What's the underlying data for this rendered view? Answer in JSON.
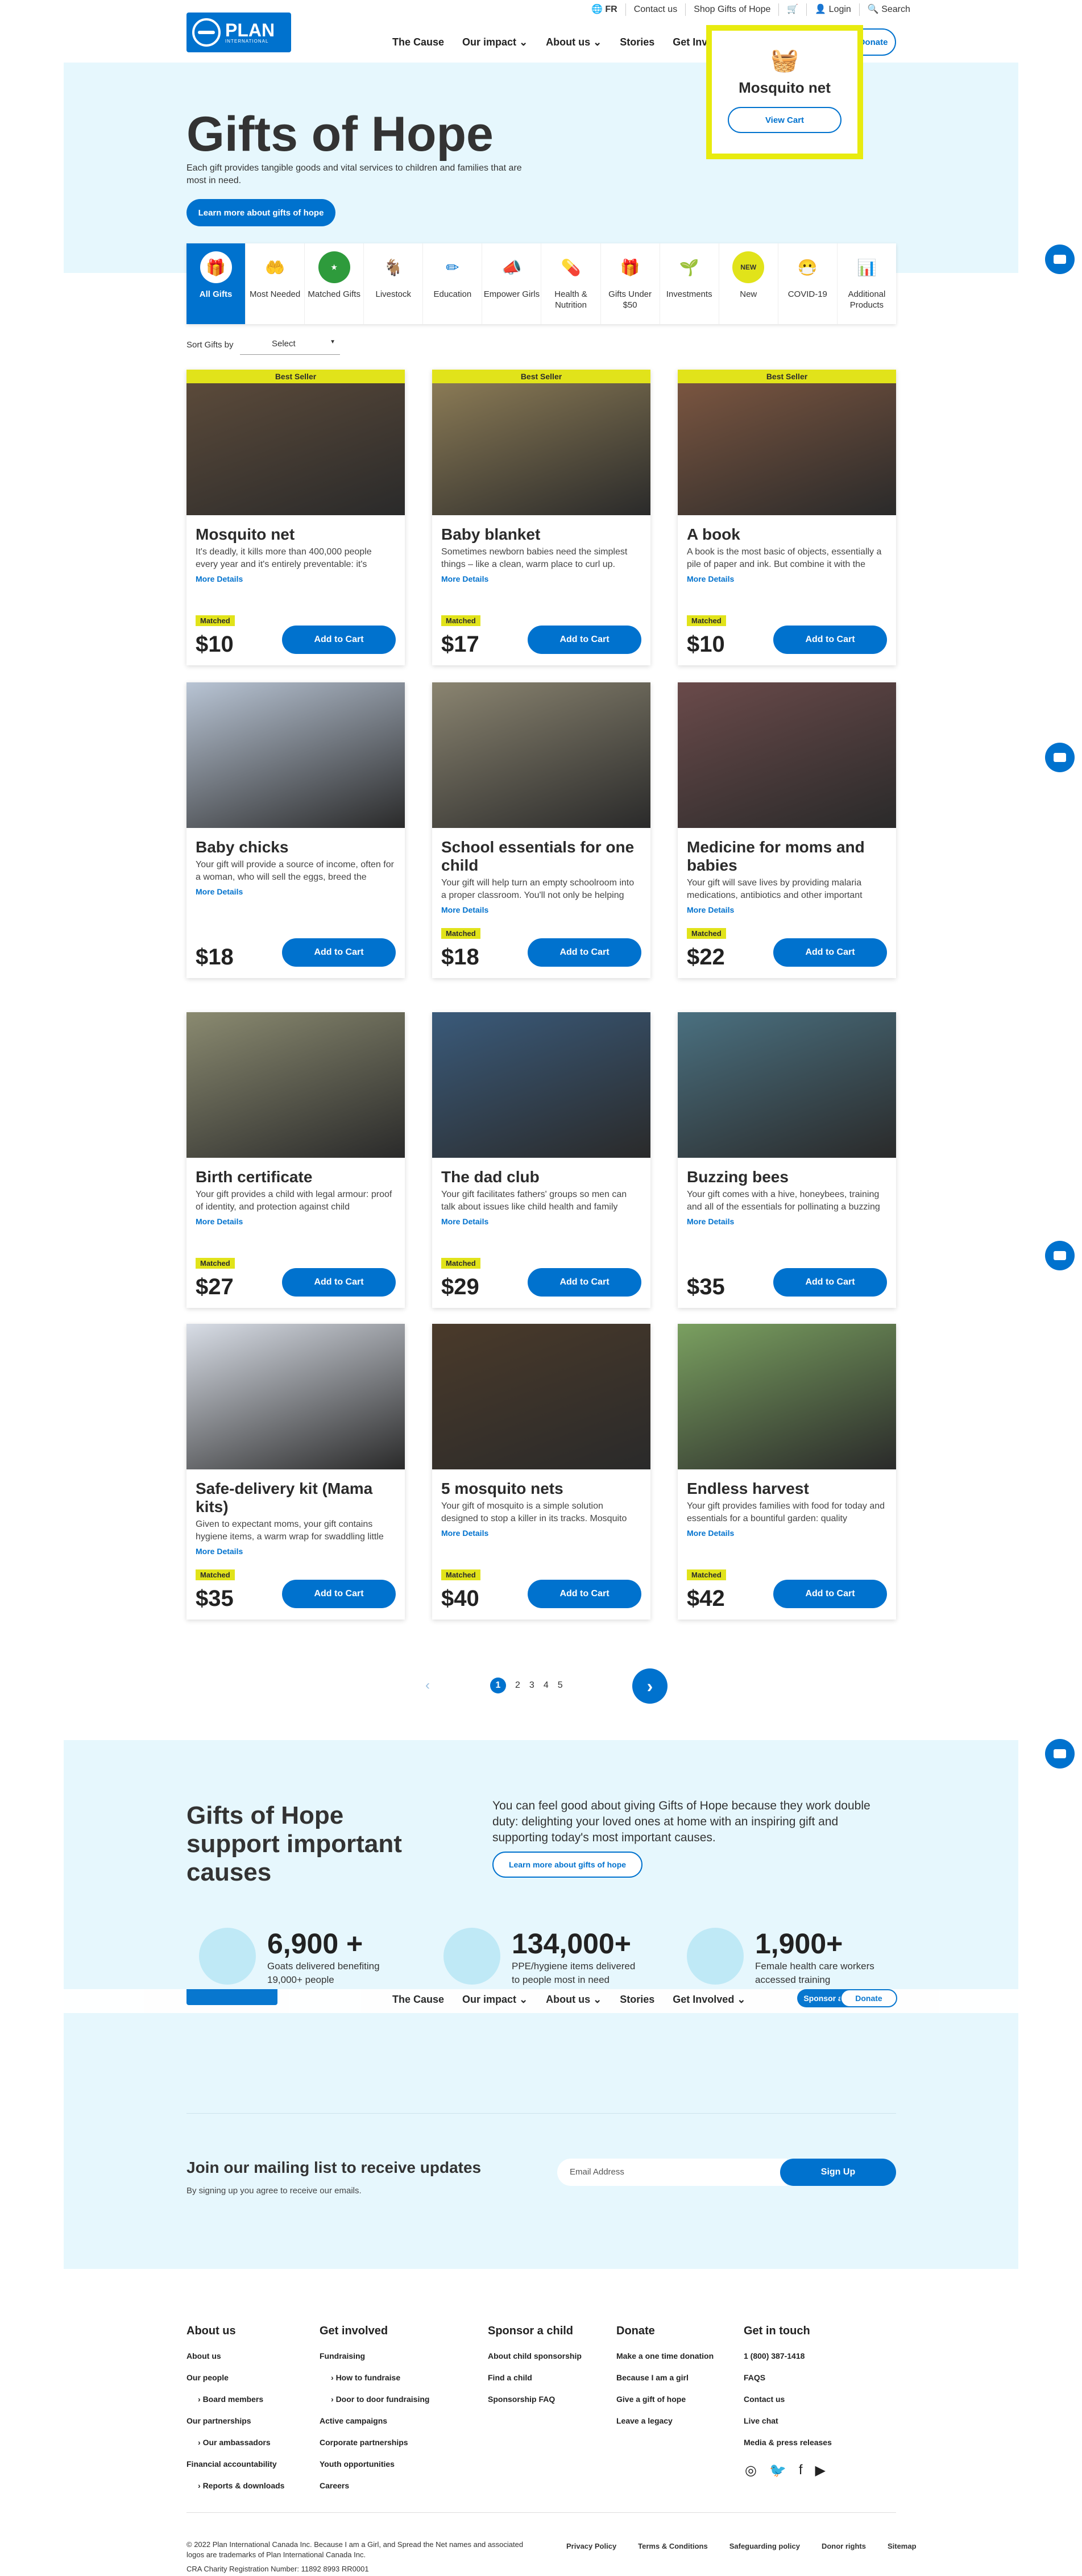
{
  "header": {
    "lang": "FR",
    "contact": "Contact us",
    "shop": "Shop Gifts of Hope",
    "login": "Login",
    "search": "Search",
    "logo_text": "PLAN",
    "logo_sub": "INTERNATIONAL",
    "nav": [
      "The Cause",
      "Our impact",
      "About us",
      "Stories",
      "Get Involved"
    ],
    "sponsor": "Sponsor a Child",
    "donate": "Donate"
  },
  "cart_popup": {
    "title": "Mosquito net",
    "button": "View Cart"
  },
  "hero": {
    "title": "Gifts of Hope",
    "desc": "Each gift provides tangible goods and vital services to children and families that are most in need.",
    "button": "Learn more about gifts of hope"
  },
  "categories": [
    {
      "label": "All Gifts"
    },
    {
      "label": "Most Needed"
    },
    {
      "label": "Matched Gifts"
    },
    {
      "label": "Livestock"
    },
    {
      "label": "Education"
    },
    {
      "label": "Empower Girls"
    },
    {
      "label": "Health & Nutrition"
    },
    {
      "label": "Gifts Under $50"
    },
    {
      "label": "Investments"
    },
    {
      "label": "New"
    },
    {
      "label": "COVID-19"
    },
    {
      "label": "Additional Products"
    }
  ],
  "sort": {
    "label": "Sort Gifts by",
    "value": "Select"
  },
  "common": {
    "best_seller": "Best Seller",
    "matched": "Matched",
    "more": "More Details",
    "add": "Add to Cart"
  },
  "products": [
    {
      "title": "Mosquito net",
      "desc": "It's deadly, it kills more than 400,000 people every year and it's entirely preventable: it's",
      "price": "$10",
      "best": true,
      "matched": true
    },
    {
      "title": "Baby blanket",
      "desc": "Sometimes newborn babies need the simplest things – like a clean, warm place to curl up.",
      "price": "$17",
      "best": true,
      "matched": true
    },
    {
      "title": "A book",
      "desc": "A book is the most basic of objects, essentially a pile of paper and ink. But combine it with the",
      "price": "$10",
      "best": true,
      "matched": true
    },
    {
      "title": "Baby chicks",
      "desc": "Your gift will provide a source of income, often for a woman, who will sell the eggs, breed the",
      "price": "$18",
      "best": false,
      "matched": false
    },
    {
      "title": "School essentials for one child",
      "desc": "Your gift will help turn an empty schoolroom into a proper classroom. You'll not only be helping",
      "price": "$18",
      "best": false,
      "matched": true
    },
    {
      "title": "Medicine for moms and babies",
      "desc": "Your gift will save lives by providing malaria medications, antibiotics and other important",
      "price": "$22",
      "best": false,
      "matched": true
    },
    {
      "title": "Birth certificate",
      "desc": "Your gift provides a child with legal armour: proof of identity, and protection against child",
      "price": "$27",
      "best": false,
      "matched": true
    },
    {
      "title": "The dad club",
      "desc": "Your gift facilitates fathers' groups so men can talk about issues like child health and family",
      "price": "$29",
      "best": false,
      "matched": true
    },
    {
      "title": "Buzzing bees",
      "desc": "Your gift comes with a hive, honeybees, training and all of the essentials for pollinating a buzzing",
      "price": "$35",
      "best": false,
      "matched": false
    },
    {
      "title": "Safe-delivery kit (Mama kits)",
      "desc": "Given to expectant moms, your gift contains hygiene items, a warm wrap for swaddling little",
      "price": "$35",
      "best": false,
      "matched": true
    },
    {
      "title": "5 mosquito nets",
      "desc": "Your gift of mosquito is a simple solution designed to stop a killer in its tracks. Mosquito",
      "price": "$40",
      "best": false,
      "matched": true
    },
    {
      "title": "Endless harvest",
      "desc": "Your gift provides families with food for today and essentials for a bountiful garden: quality",
      "price": "$42",
      "best": false,
      "matched": true
    }
  ],
  "pagination": {
    "pages": [
      "1",
      "2",
      "3",
      "4",
      "5"
    ],
    "current": "1"
  },
  "support": {
    "title": "Gifts of Hope support important causes",
    "text": "You can feel good about giving Gifts of Hope because they work double duty: delighting your loved ones at home with an inspiring gift and supporting today's most important causes.",
    "button": "Learn more about gifts of hope"
  },
  "stats": [
    {
      "num": "6,900 +",
      "label": "Goats delivered benefiting 19,000+ people"
    },
    {
      "num": "134,000+",
      "label": "PPE/hygiene items delivered to people most in need"
    },
    {
      "num": "1,900+",
      "label": "Female health care workers accessed training"
    }
  ],
  "mailing": {
    "title": "Join our mailing list to receive updates",
    "sub": "By signing up you agree to receive our emails.",
    "placeholder": "Email Address",
    "button": "Sign Up"
  },
  "footer": {
    "cols": [
      {
        "title": "About us",
        "items": [
          "About us",
          "Our people",
          "Board members",
          "Our partnerships",
          "Our ambassadors",
          "Financial accountability",
          "Reports & downloads"
        ],
        "subs": [
          false,
          false,
          true,
          false,
          true,
          false,
          true
        ]
      },
      {
        "title": "Get involved",
        "items": [
          "Fundraising",
          "How to fundraise",
          "Door to door fundraising",
          "Active campaigns",
          "Corporate partnerships",
          "Youth opportunities",
          "Careers"
        ],
        "subs": [
          false,
          true,
          true,
          false,
          false,
          false,
          false
        ]
      },
      {
        "title": "Sponsor a child",
        "items": [
          "About child sponsorship",
          "Find a child",
          "Sponsorship FAQ"
        ],
        "subs": [
          false,
          false,
          false
        ]
      },
      {
        "title": "Donate",
        "items": [
          "Make a one time donation",
          "Because I am a girl",
          "Give a gift of hope",
          "Leave a legacy"
        ],
        "subs": [
          false,
          false,
          false,
          false
        ]
      },
      {
        "title": "Get in touch",
        "items": [
          "1 (800) 387-1418",
          "FAQS",
          "Contact us",
          "Live chat",
          "Media & press releases"
        ],
        "subs": [
          false,
          false,
          false,
          false,
          false
        ]
      }
    ],
    "legal": "© 2022 Plan International Canada Inc. Because I am a Girl, and Spread the Net names and associated logos are trademarks of Plan International Canada Inc.",
    "cra": "CRA Charity Registration Number: 11892 8993 RR0001",
    "links": [
      "Privacy Policy",
      "Terms & Conditions",
      "Safeguarding policy",
      "Donor rights",
      "Sitemap"
    ]
  },
  "colors": {
    "brand": "#0072ce",
    "highlight": "#e1e31a",
    "band": "#e6f7fd"
  }
}
